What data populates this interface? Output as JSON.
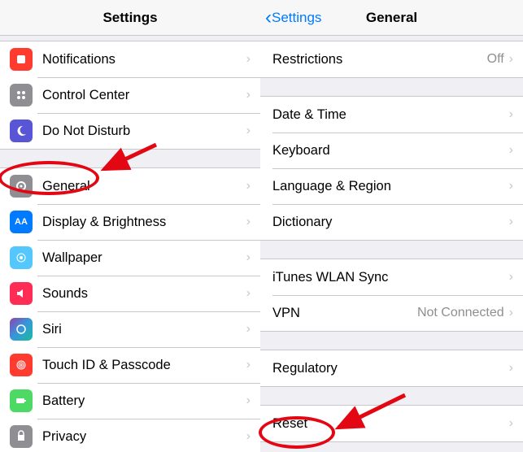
{
  "left": {
    "title": "Settings",
    "group1": [
      {
        "label": "Notifications"
      },
      {
        "label": "Control Center"
      },
      {
        "label": "Do Not Disturb"
      }
    ],
    "group2": [
      {
        "label": "General"
      },
      {
        "label": "Display & Brightness"
      },
      {
        "label": "Wallpaper"
      },
      {
        "label": "Sounds"
      },
      {
        "label": "Siri"
      },
      {
        "label": "Touch ID & Passcode"
      },
      {
        "label": "Battery"
      },
      {
        "label": "Privacy"
      }
    ]
  },
  "right": {
    "back": "Settings",
    "title": "General",
    "group1": [
      {
        "label": "Restrictions",
        "value": "Off"
      }
    ],
    "group2": [
      {
        "label": "Date & Time"
      },
      {
        "label": "Keyboard"
      },
      {
        "label": "Language & Region"
      },
      {
        "label": "Dictionary"
      }
    ],
    "group3": [
      {
        "label": "iTunes WLAN Sync"
      },
      {
        "label": "VPN",
        "value": "Not Connected"
      }
    ],
    "group4": [
      {
        "label": "Regulatory"
      }
    ],
    "group5": [
      {
        "label": "Reset"
      }
    ]
  }
}
